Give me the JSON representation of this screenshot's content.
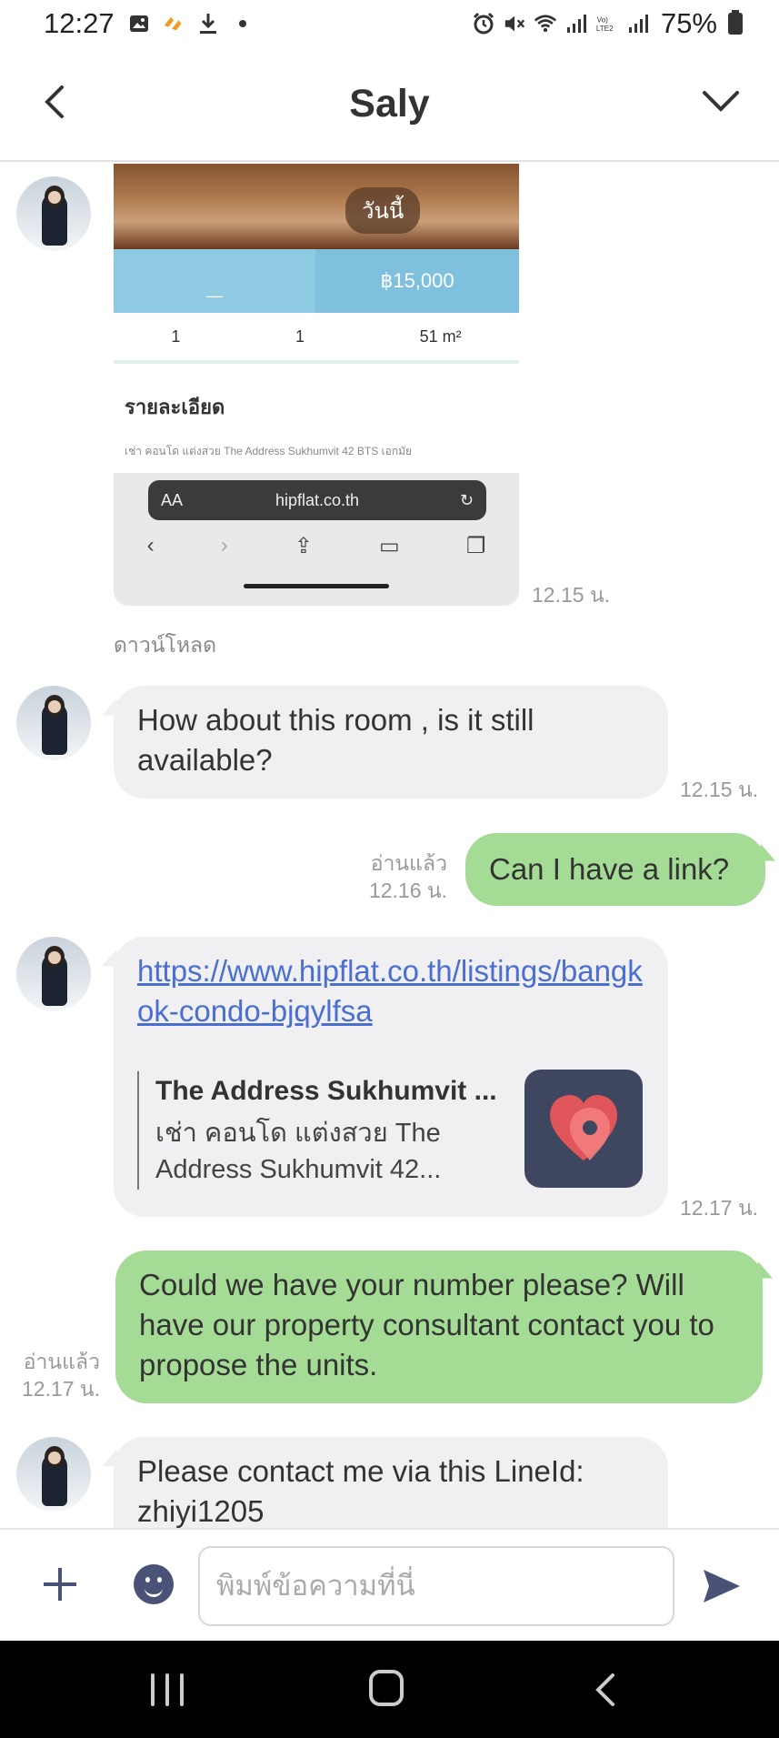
{
  "status_bar": {
    "time": "12:27",
    "battery": "75%"
  },
  "header": {
    "title": "Saly"
  },
  "messages": {
    "image_msg": {
      "today_label": "วันนี้",
      "price_text": "฿15,000",
      "stat1": "1",
      "stat2": "1",
      "stat3": "51 m²",
      "detail_heading": "รายละเอียด",
      "detail_line": "เช่า คอนโด แต่งสวย The Address Sukhumvit 42 BTS เอกมัย",
      "url": "hipflat.co.th",
      "aa": "AA",
      "time": "12.15 น.",
      "download": "ดาวน์โหลด"
    },
    "msg1": {
      "text": "How about this room , is it still available?",
      "time": "12.15 น."
    },
    "msg2": {
      "text": "Can I have a link?",
      "read": "อ่านแล้ว",
      "time": "12.16 น."
    },
    "msg3": {
      "link": "https://www.hipflat.co.th/listings/bangkok-condo-bjqylfsa",
      "preview_title": "The Address Sukhumvit ...",
      "preview_desc": "เช่า คอนโด แต่งสวย The Address Sukhumvit 42...",
      "time": "12.17 น."
    },
    "msg4": {
      "text": "Could we have your number please? Will have our property consultant contact you to propose the units.",
      "read": "อ่านแล้ว",
      "time": "12.17 น."
    },
    "msg5": {
      "text": "Please contact me via this LineId: zhiyi1205"
    }
  },
  "input_bar": {
    "placeholder": "พิมพ์ข้อความที่นี่"
  },
  "colors": {
    "incoming_bubble": "#f0f0f3",
    "outgoing_bubble": "#a5dc95",
    "link": "#4a6fd0"
  }
}
